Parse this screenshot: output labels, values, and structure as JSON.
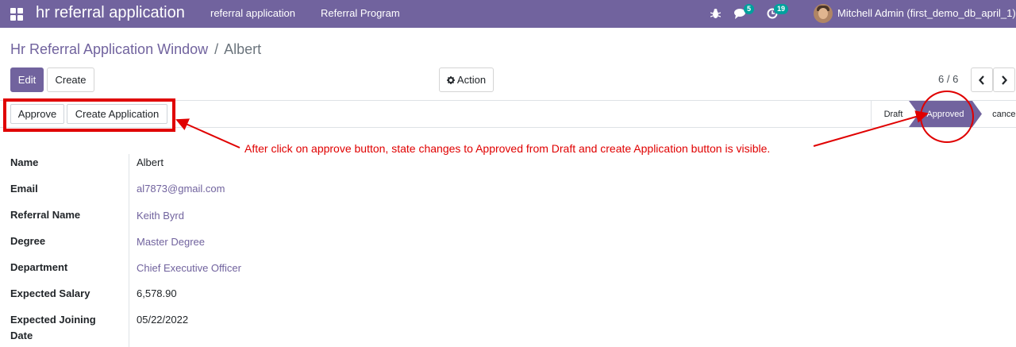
{
  "navbar": {
    "app_title": "hr referral application",
    "menu": [
      "referral application",
      "Referral Program"
    ],
    "messages_count": "5",
    "activities_count": "19",
    "user": "Mitchell Admin (first_demo_db_april_1)",
    "icons": [
      "apps-icon",
      "bug-icon",
      "chat-icon",
      "clock-icon"
    ]
  },
  "breadcrumb": {
    "parent": "Hr Referral Application Window",
    "separator": "/",
    "current": "Albert"
  },
  "control_panel": {
    "edit_label": "Edit",
    "create_label": "Create",
    "action_label": "Action",
    "pager": "6 / 6"
  },
  "statusbar": {
    "approve_label": "Approve",
    "create_application_label": "Create Application",
    "stages": [
      "Draft",
      "Approved",
      "cancel"
    ],
    "active_stage": "Approved"
  },
  "annotation": "After click on approve button, state changes to Approved from Draft and create Application button is visible.",
  "form": {
    "fields": [
      {
        "label": "Name",
        "value": "Albert"
      },
      {
        "label": "Email",
        "value": "al7873@gmail.com"
      },
      {
        "label": "Referral Name",
        "value": "Keith Byrd"
      },
      {
        "label": "Degree",
        "value": "Master Degree"
      },
      {
        "label": "Department",
        "value": "Chief Executive Officer"
      },
      {
        "label": "Expected Salary",
        "value": "6,578.90"
      },
      {
        "label": "Expected Joining",
        "label_2": "Date",
        "value": "05/22/2022"
      }
    ]
  },
  "colors": {
    "brand": "#71639e",
    "annotation": "#e00000",
    "badge": "#00a09d"
  }
}
